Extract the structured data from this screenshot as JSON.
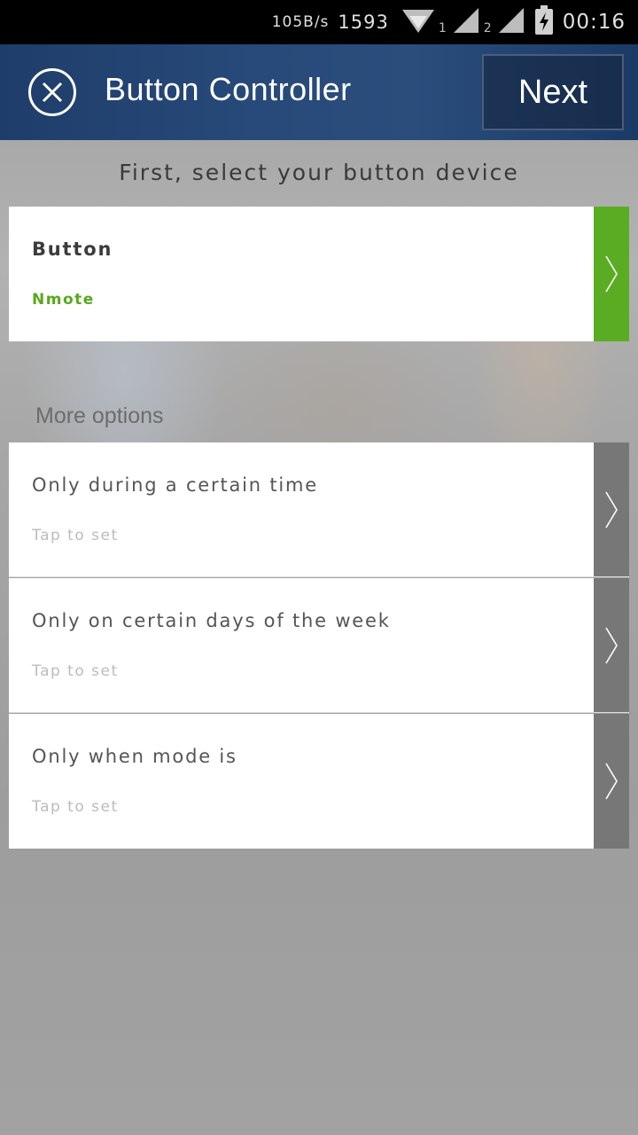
{
  "status_bar": {
    "speed": "105B/s",
    "count": "1593",
    "sim1": "1",
    "sim2": "2",
    "time": "00:16"
  },
  "header": {
    "title": "Button Controller",
    "next_label": "Next",
    "close_icon": "close-circle-icon"
  },
  "device_section": {
    "heading": "First, select your button device",
    "item": {
      "title": "Button",
      "subtitle": "Nmote",
      "accent": "#5aad23"
    }
  },
  "more_options": {
    "heading": "More options",
    "items": [
      {
        "title": "Only during a certain time",
        "subtitle": "Tap to set"
      },
      {
        "title": "Only on certain days of the week",
        "subtitle": "Tap to set"
      },
      {
        "title": "Only when mode is",
        "subtitle": "Tap to set"
      }
    ]
  },
  "colors": {
    "header_bg": "#274a7a",
    "chevron_gray": "#777777"
  }
}
